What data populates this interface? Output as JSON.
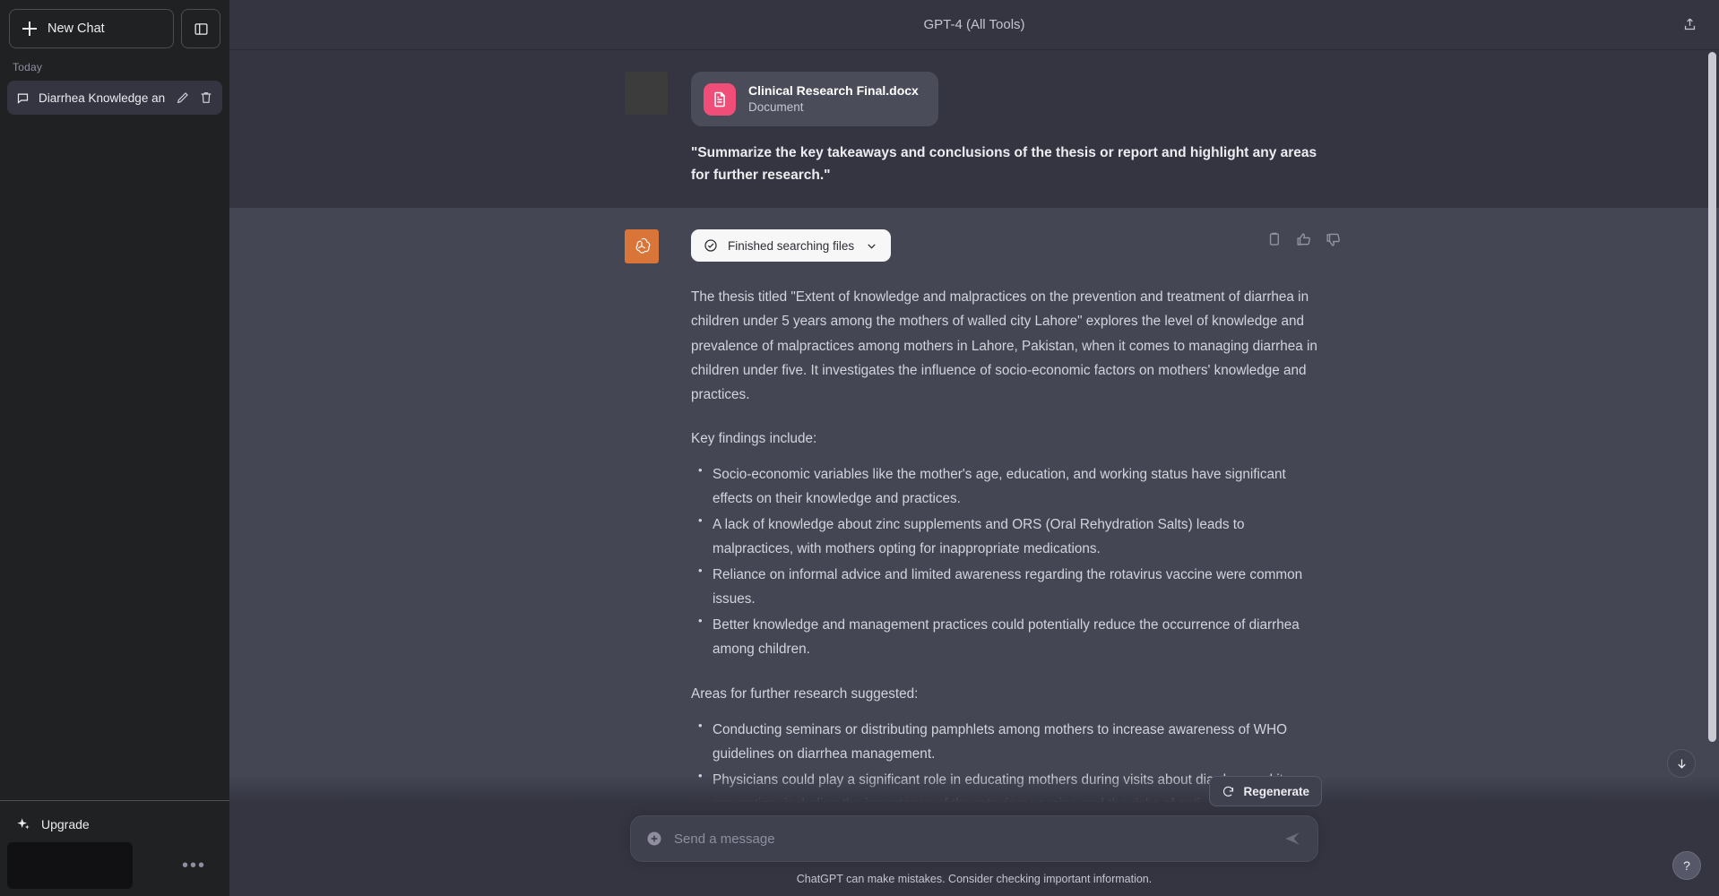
{
  "sidebar": {
    "new_chat_label": "New Chat",
    "collapse_icon": "panel-left-icon",
    "section_label": "Today",
    "chats": [
      {
        "title": "Diarrhea Knowledge an",
        "chat_icon": "chat-bubble-icon",
        "edit_icon": "pencil-icon",
        "delete_icon": "trash-icon"
      }
    ],
    "upgrade_label": "Upgrade",
    "upgrade_icon": "sparkle-icon",
    "profile_menu_icon": "ellipsis-icon"
  },
  "header": {
    "title": "GPT-4 (All Tools)",
    "share_icon": "share-upload-icon"
  },
  "user_turn": {
    "file_card": {
      "name": "Clinical Research Final.docx",
      "kind": "Document",
      "icon": "document-icon",
      "icon_color": "#f04e79"
    },
    "message": "\"Summarize the key takeaways and conclusions of the thesis or report and highlight any areas for further research.\""
  },
  "assistant_turn": {
    "avatar_icon": "openai-logo-icon",
    "avatar_color": "#d97539",
    "tool_pill": {
      "label": "Finished searching files",
      "status_icon": "check-circle-icon",
      "expand_icon": "chevron-down-icon"
    },
    "actions": [
      {
        "name": "copy-icon"
      },
      {
        "name": "thumbs-up-icon"
      },
      {
        "name": "thumbs-down-icon"
      }
    ],
    "paragraph": "The thesis titled \"Extent of knowledge and malpractices on the prevention and treatment of diarrhea in children under 5 years among the mothers of walled city Lahore\" explores the level of knowledge and prevalence of malpractices among mothers in Lahore, Pakistan, when it comes to managing diarrhea in children under five. It investigates the influence of socio-economic factors on mothers' knowledge and practices.",
    "findings_heading": "Key findings include:",
    "findings": [
      "Socio-economic variables like the mother's age, education, and working status have significant effects on their knowledge and practices.",
      "A lack of knowledge about zinc supplements and ORS (Oral Rehydration Salts) leads to malpractices, with mothers opting for inappropriate medications.",
      "Reliance on informal advice and limited awareness regarding the rotavirus vaccine were common issues.",
      "Better knowledge and management practices could potentially reduce the occurrence of diarrhea among children."
    ],
    "research_heading": "Areas for further research suggested:",
    "research": [
      "Conducting seminars or distributing pamphlets among mothers to increase awareness of WHO guidelines on diarrhea management.",
      "Physicians could play a significant role in educating mothers during visits about diarrhea and its prevention, including the importance of the rotavirus vaccine and the risks of anti-"
    ]
  },
  "composer": {
    "regenerate_label": "Regenerate",
    "regenerate_icon": "refresh-icon",
    "attach_icon": "plus-circle-icon",
    "placeholder": "Send a message",
    "value": "",
    "send_icon": "send-arrow-icon",
    "disclaimer": "ChatGPT can make mistakes. Consider checking important information."
  },
  "floating": {
    "scroll_icon": "arrow-down-icon",
    "help_label": "?"
  }
}
